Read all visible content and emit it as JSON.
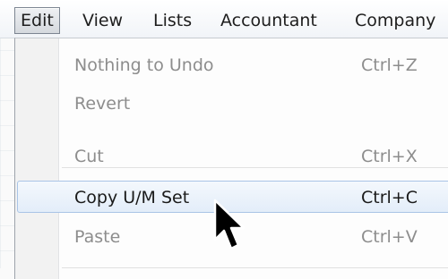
{
  "menubar": {
    "items": [
      {
        "label": "Edit",
        "active": true
      },
      {
        "label": "View"
      },
      {
        "label": "Lists"
      },
      {
        "label": "Accountant"
      },
      {
        "label": "Company"
      }
    ]
  },
  "edit_menu": {
    "items": [
      {
        "label": "Nothing to Undo",
        "shortcut": "Ctrl+Z",
        "enabled": false
      },
      {
        "label": "Revert",
        "shortcut": "",
        "enabled": false
      },
      {
        "label": "Cut",
        "shortcut": "Ctrl+X",
        "enabled": false
      },
      {
        "label": "Copy U/M Set",
        "shortcut": "Ctrl+C",
        "enabled": true,
        "highlighted": true
      },
      {
        "label": "Paste",
        "shortcut": "Ctrl+V",
        "enabled": false
      }
    ]
  },
  "icons": {
    "cursor": "mouse-pointer-icon"
  }
}
